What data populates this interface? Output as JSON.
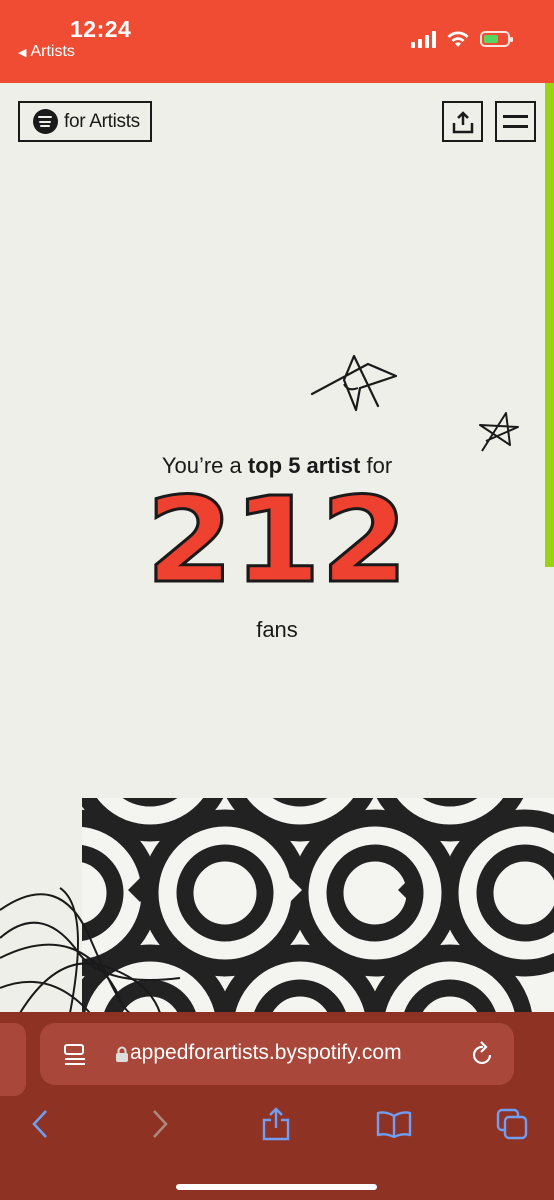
{
  "status_bar": {
    "time": "12:24",
    "back_label": "Artists",
    "back_icon": "back-triangle",
    "icons": [
      "cellular-signal-icon",
      "wifi-icon",
      "battery-charging-icon"
    ],
    "color": "#f04b33"
  },
  "header": {
    "logo_text": "for Artists",
    "logo_icon": "spotify-icon",
    "share_icon": "share-icon",
    "menu_icon": "hamburger-menu-icon"
  },
  "main": {
    "headline_prefix": "You’re a ",
    "headline_bold": "top 5 artist",
    "headline_suffix": " for",
    "number": "212",
    "unit": "fans",
    "number_color": "#ee4130",
    "progress_color": "#9bd312"
  },
  "browser": {
    "url": "appedforartists.byspotify.com",
    "reader_icon": "reader-icon",
    "lock_icon": "lock-icon",
    "reload_icon": "reload-icon",
    "toolbar": [
      "back-icon",
      "forward-icon",
      "share-icon",
      "bookmarks-icon",
      "tabs-icon"
    ],
    "chrome_color": "#8e3224"
  }
}
